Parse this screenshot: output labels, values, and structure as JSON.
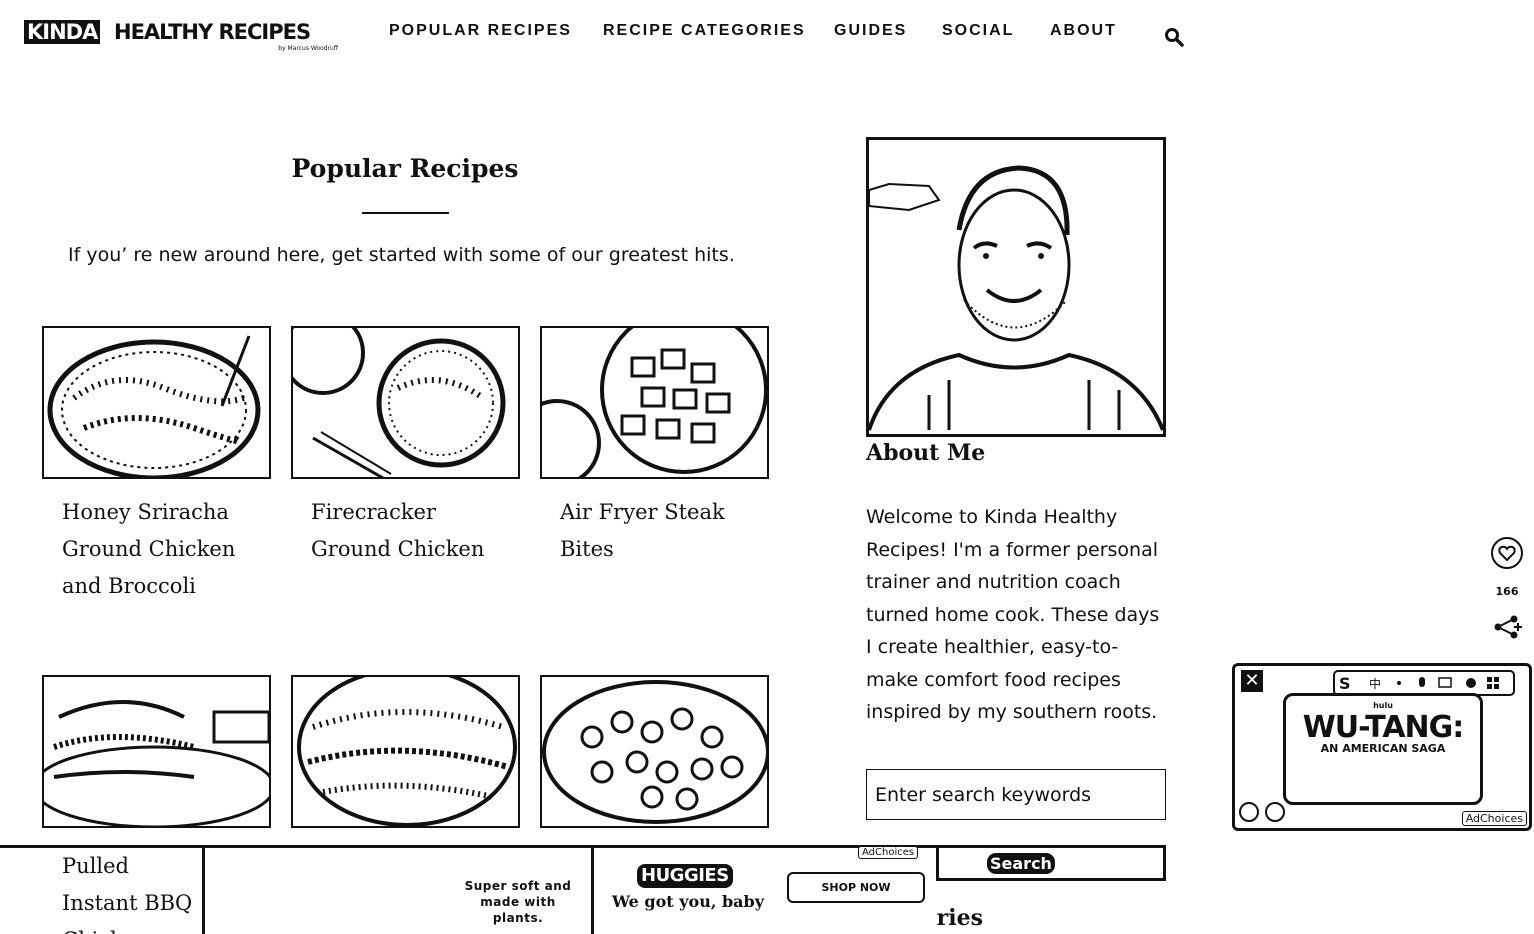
{
  "header": {
    "logo_kinda": "KINDA",
    "logo_main": "HEALTHY RECIPES",
    "logo_byline": "by Marcus Woodruff",
    "nav": [
      "POPULAR RECIPES",
      "RECIPE CATEGORIES",
      "GUIDES",
      "SOCIAL",
      "ABOUT"
    ]
  },
  "main": {
    "title": "Popular Recipes",
    "intro": "If you’   re new around here, get started with some of our greatest hits.",
    "recipes": [
      {
        "title": "Honey Sriracha Ground Chicken and Broccoli"
      },
      {
        "title": "Firecracker Ground Chicken"
      },
      {
        "title": "Air Fryer Steak Bites"
      },
      {
        "title": "Pulled Instant BBQ Chicken"
      },
      {
        "title": ""
      },
      {
        "title": ""
      }
    ]
  },
  "sidebar": {
    "about_title": "About Me",
    "about_text": "Welcome to Kinda Healthy Recipes! I'm a former personal trainer and nutrition coach turned home cook. These days I create healthier, easy-to-make comfort food recipes inspired by my southern roots.",
    "search_placeholder": "Enter search keywords",
    "search_button": "Search",
    "categories_heading": "ories"
  },
  "share": {
    "count": "166"
  },
  "video_ad": {
    "brand": "hulu",
    "title": "WU-TANG:",
    "subtitle": "AN AMERICAN SAGA",
    "adchoices": "AdChoices"
  },
  "banner_ad": {
    "tagline": "Super soft and made with plants.",
    "brand": "HUGGIES",
    "brand_tagline": "We got you, baby",
    "cta": "SHOP NOW",
    "adchoices": "AdChoices"
  },
  "colors": {
    "ink": "#111111",
    "paper": "#ffffff"
  }
}
